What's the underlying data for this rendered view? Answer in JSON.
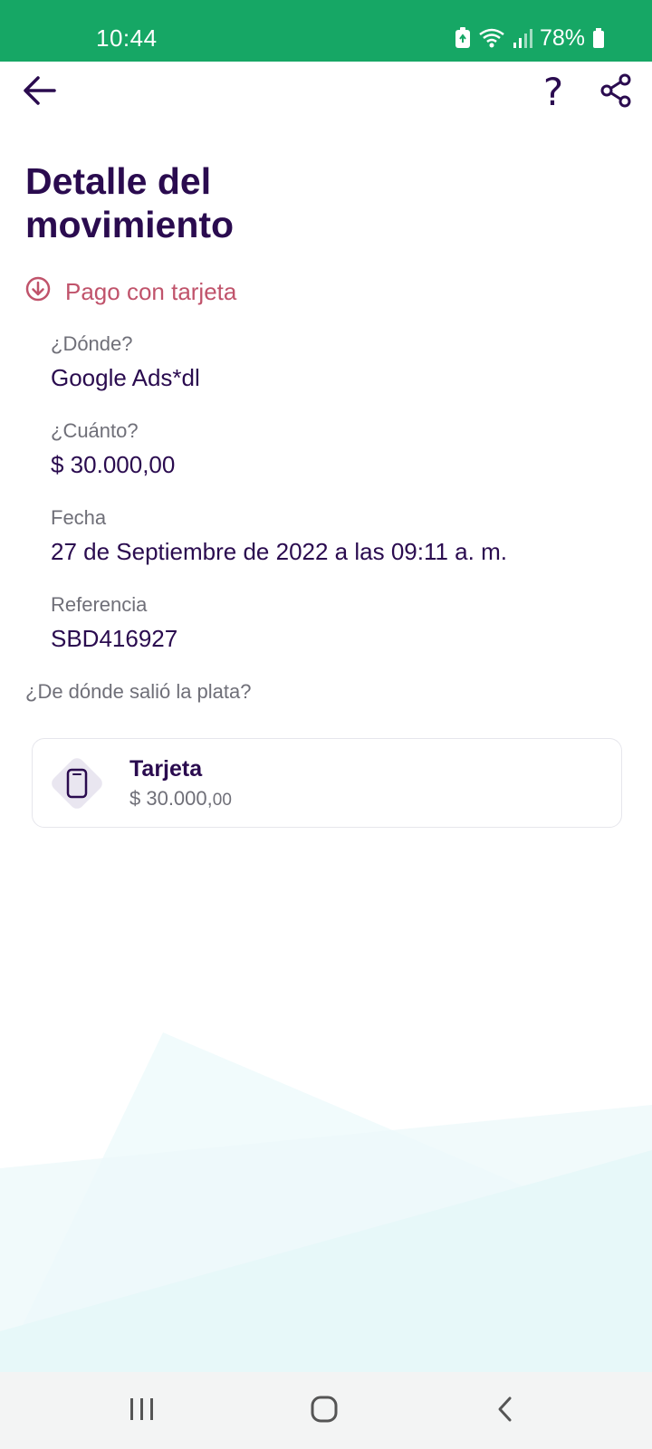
{
  "status_bar": {
    "time": "10:44",
    "battery_percent": "78%",
    "icons": [
      "battery-saver-icon",
      "wifi-icon",
      "signal-icon",
      "battery-icon"
    ]
  },
  "top_bar": {
    "icons": [
      "arrow-left-icon",
      "help-icon",
      "share-icon"
    ],
    "help_glyph": "?"
  },
  "page": {
    "title": "Detalle del movimiento"
  },
  "transaction": {
    "type_label": "Pago con tarjeta",
    "type_icon": "arrow-down-circle-icon",
    "type_color": "#c0536b",
    "fields": [
      {
        "label": "¿Dónde?",
        "value": "Google Ads*dl"
      },
      {
        "label": "¿Cuánto?",
        "value": "$ 30.000,00"
      },
      {
        "label": "Fecha",
        "value": "27 de Septiembre de 2022 a las 09:11 a. m."
      },
      {
        "label": "Referencia",
        "value": "SBD416927"
      }
    ]
  },
  "source": {
    "question": "¿De dónde salió la plata?",
    "card": {
      "icon": "card-icon",
      "name": "Tarjeta",
      "amount_main": "$ 30.000,",
      "amount_cents": "00"
    }
  },
  "nav_bar": {
    "icons": [
      "recent-apps-icon",
      "home-icon",
      "back-icon"
    ]
  },
  "colors": {
    "status_bar": "#16a765",
    "primary_text": "#2a0b4f",
    "secondary_text": "#6f6f78",
    "accent_negative": "#c0536b"
  }
}
